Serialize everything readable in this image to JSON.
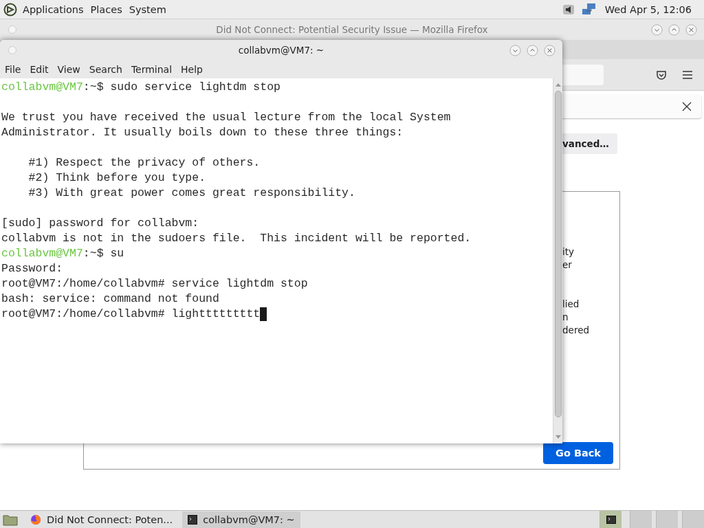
{
  "top_panel": {
    "menus": [
      "Applications",
      "Places",
      "System"
    ],
    "clock": "Wed Apr 5, 12:06"
  },
  "firefox": {
    "title": "Did Not Connect: Potential Security Issue — Mozilla Firefox",
    "advanced_button": "vanced…",
    "box_lines": [
      {
        "kind": "gap"
      },
      {
        "kind": "gap"
      },
      {
        "kind": "gap"
      },
      {
        "kind": "gap"
      },
      {
        "kind": "text",
        "text": "ity"
      },
      {
        "kind": "text",
        "text": "er"
      },
      {
        "kind": "gap"
      },
      {
        "kind": "gap"
      },
      {
        "kind": "text",
        "text": "lied"
      },
      {
        "kind": "text",
        "text": "n"
      },
      {
        "kind": "text",
        "text": "dered"
      }
    ],
    "go_back": "Go Back"
  },
  "terminal": {
    "title": "collabvm@VM7: ~",
    "menu": [
      "File",
      "Edit",
      "View",
      "Search",
      "Terminal",
      "Help"
    ],
    "lines": [
      {
        "kind": "prompt",
        "user": "collabvm@VM7",
        "path": ":~$",
        "text": " sudo service lightdm stop"
      },
      {
        "kind": "blank"
      },
      {
        "kind": "output",
        "text": "We trust you have received the usual lecture from the local System"
      },
      {
        "kind": "output",
        "text": "Administrator. It usually boils down to these three things:"
      },
      {
        "kind": "blank"
      },
      {
        "kind": "output",
        "text": "    #1) Respect the privacy of others."
      },
      {
        "kind": "output",
        "text": "    #2) Think before you type."
      },
      {
        "kind": "output",
        "text": "    #3) With great power comes great responsibility."
      },
      {
        "kind": "blank"
      },
      {
        "kind": "output",
        "text": "[sudo] password for collabvm:"
      },
      {
        "kind": "output",
        "text": "collabvm is not in the sudoers file.  This incident will be reported."
      },
      {
        "kind": "prompt",
        "user": "collabvm@VM7",
        "path": ":~$",
        "text": " su"
      },
      {
        "kind": "output",
        "text": "Password:"
      },
      {
        "kind": "output",
        "text": "root@VM7:/home/collabvm# service lightdm stop"
      },
      {
        "kind": "output",
        "text": "bash: service: command not found"
      },
      {
        "kind": "input",
        "text": "root@VM7:/home/collabvm# lighttttttttt"
      }
    ]
  },
  "taskbar": {
    "tasks": [
      {
        "kind": "browser",
        "label": "Did Not Connect: Poten...",
        "selected": false
      },
      {
        "kind": "terminal",
        "label": "collabvm@VM7: ~",
        "selected": true
      }
    ]
  }
}
